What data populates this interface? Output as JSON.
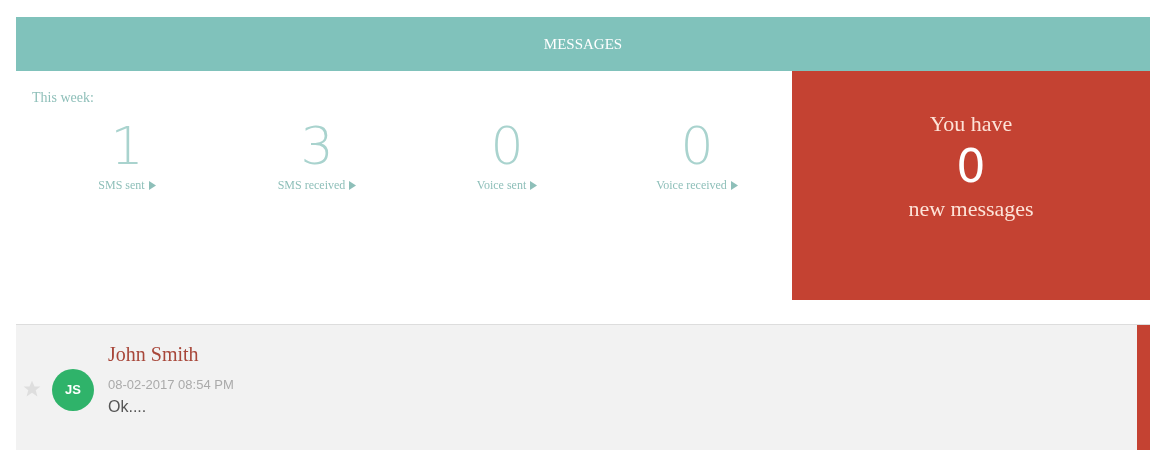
{
  "header": {
    "title": "MESSAGES"
  },
  "stats": {
    "period_label": "This week:",
    "items": [
      {
        "value": "1",
        "label": "SMS sent"
      },
      {
        "value": "3",
        "label": "SMS received"
      },
      {
        "value": "0",
        "label": "Voice sent"
      },
      {
        "value": "0",
        "label": "Voice received"
      }
    ]
  },
  "summary": {
    "prefix": "You have",
    "count": "0",
    "suffix": "new messages"
  },
  "messages": [
    {
      "starred": false,
      "initials": "JS",
      "color": "#2fb36a",
      "sender": "John Smith",
      "time": "08-02-2017 08:54 PM",
      "preview": "Ok...."
    }
  ]
}
